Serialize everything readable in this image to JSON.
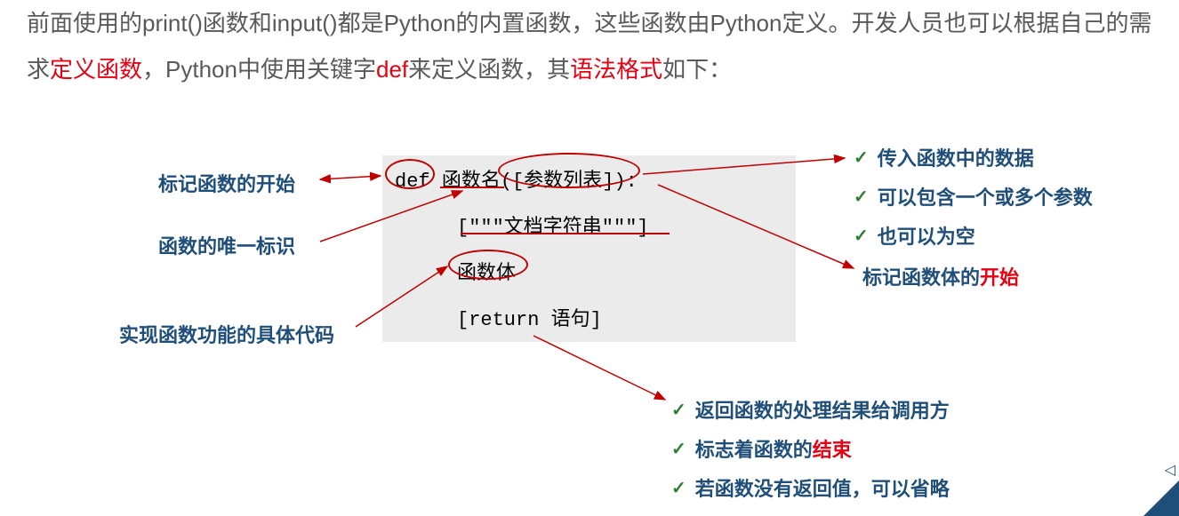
{
  "intro": {
    "part1": "前面使用的print()函数和input()都是Python的内置函数，这些函数由Python定义。开发人员也可以根据自己的需求",
    "define_func": "定义函数",
    "part2": "，Python中使用关键字",
    "def_kw": "def",
    "part3": "来定义函数，其",
    "syntax": "语法格式",
    "part4": "如下："
  },
  "code": {
    "def": "def",
    "funcname": "函数名",
    "paren_open": "(",
    "bracket_open": "[",
    "params": "参数列表",
    "bracket_close": "]",
    "paren_close": ")",
    "colon": ":",
    "docstring": "[\"\"\"文档字符串\"\"\"]",
    "body": "函数体",
    "return_stmt": "[return 语句]"
  },
  "labels": {
    "mark_start": "标记函数的开始",
    "unique_id": "函数的唯一标识",
    "impl_code": "实现函数功能的具体代码",
    "param1": "传入函数中的数据",
    "param2": "可以包含一个或多个参数",
    "param3": "也可以为空",
    "body_start_pre": "标记函数体的",
    "body_start_red": "开始",
    "return1": "返回函数的处理结果给调用方",
    "return2_pre": "标志着函数的",
    "return2_red": "结束",
    "return3": "若函数没有返回值，可以省略"
  }
}
